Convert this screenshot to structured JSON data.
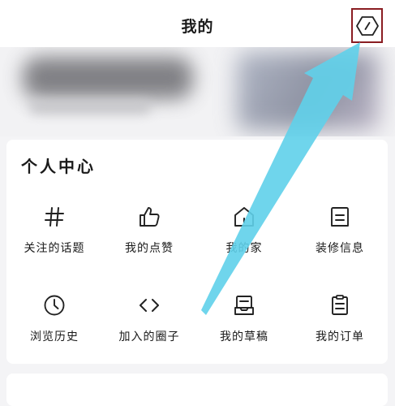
{
  "header": {
    "title": "我的"
  },
  "icons": {
    "settings": "hexagon-edit-icon"
  },
  "personal_center": {
    "title": "个人中心",
    "items": [
      {
        "label": "关注的话题",
        "icon": "hashtag-icon"
      },
      {
        "label": "我的点赞",
        "icon": "thumbs-up-icon"
      },
      {
        "label": "我的家",
        "icon": "home-icon"
      },
      {
        "label": "装修信息",
        "icon": "document-icon"
      },
      {
        "label": "浏览历史",
        "icon": "clock-icon"
      },
      {
        "label": "加入的圈子",
        "icon": "code-brackets-icon"
      },
      {
        "label": "我的草稿",
        "icon": "draft-box-icon"
      },
      {
        "label": "我的订单",
        "icon": "clipboard-icon"
      }
    ]
  },
  "colors": {
    "highlight_border": "#8a1d22",
    "arrow": "#5fd0ea"
  }
}
